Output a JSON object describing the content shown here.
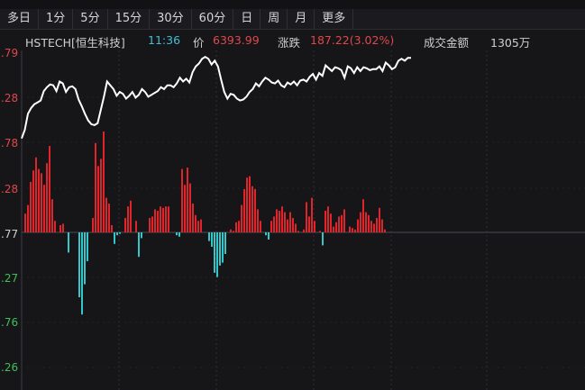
{
  "tabs": [
    {
      "label": "多日"
    },
    {
      "label": "1分"
    },
    {
      "label": "5分"
    },
    {
      "label": "15分"
    },
    {
      "label": "30分"
    },
    {
      "label": "60分"
    },
    {
      "label": "日"
    },
    {
      "label": "周"
    },
    {
      "label": "月"
    },
    {
      "label": "更多"
    }
  ],
  "quote": {
    "symbol": "HSTECH[恒生科技]",
    "time": "11:36",
    "price_label": "价",
    "price": "6393.99",
    "change_label": "涨跌",
    "change": "187.22(3.02%)",
    "amount_label": "成交金额",
    "amount": "1305万"
  },
  "colors": {
    "background": "#161619",
    "price_line": "#ffffff",
    "up": "#e0242b",
    "down": "#33c7c9",
    "axis_up_label": "#e0474b",
    "axis_down_label": "#3fbf5a",
    "symbol_text": "#cfcfcf",
    "time_text": "#3fbfd6",
    "value_text": "#e0474b"
  },
  "chart_data": {
    "type": "line",
    "price_axis": {
      "tick_labels": [
        ".79",
        ".28",
        ".78",
        ".28",
        ".77",
        ".27",
        ".76",
        ".26"
      ]
    },
    "price_line_values": [
      6206,
      6215,
      6232,
      6238,
      6242,
      6244,
      6246,
      6256,
      6260,
      6263,
      6262,
      6256,
      6266,
      6264,
      6255,
      6260,
      6261,
      6258,
      6247,
      6240,
      6232,
      6225,
      6221,
      6220,
      6222,
      6236,
      6250,
      6266,
      6262,
      6258,
      6251,
      6255,
      6253,
      6248,
      6251,
      6255,
      6249,
      6252,
      6258,
      6255,
      6250,
      6252,
      6254,
      6256,
      6260,
      6258,
      6262,
      6262,
      6260,
      6264,
      6270,
      6266,
      6269,
      6265,
      6276,
      6282,
      6285,
      6290,
      6292,
      6290,
      6284,
      6288,
      6282,
      6268,
      6255,
      6248,
      6253,
      6252,
      6248,
      6246,
      6247,
      6250,
      6255,
      6258,
      6264,
      6261,
      6266,
      6270,
      6268,
      6265,
      6264,
      6267,
      6262,
      6260,
      6265,
      6263,
      6266,
      6262,
      6267,
      6268,
      6266,
      6271,
      6274,
      6268,
      6275,
      6272,
      6283,
      6280,
      6277,
      6281,
      6280,
      6278,
      6270,
      6282,
      6280,
      6275,
      6281,
      6277,
      6281,
      6280,
      6278,
      6279,
      6279,
      6282,
      6277,
      6286,
      6283,
      6279,
      6281,
      6288,
      6290,
      6288,
      6291,
      6291
    ],
    "bar_values": [
      13,
      19,
      35,
      43,
      52,
      44,
      41,
      33,
      48,
      60,
      23,
      8,
      0,
      5,
      6,
      0,
      -14,
      0,
      0,
      0,
      -45,
      -57,
      -36,
      -20,
      0,
      10,
      62,
      46,
      51,
      70,
      24,
      20,
      5,
      -8,
      -2,
      -1,
      0,
      10,
      18,
      22,
      0,
      8,
      -17,
      -4,
      0,
      0,
      10,
      11,
      16,
      15,
      18,
      17,
      18,
      18,
      0,
      0,
      -2,
      -3,
      44,
      33,
      45,
      34,
      20,
      12,
      8,
      9,
      0,
      0,
      -6,
      -10,
      -28,
      -31,
      -23,
      -21,
      -15,
      0,
      2,
      1,
      7,
      8,
      19,
      30,
      38,
      39,
      32,
      30,
      16,
      8,
      0,
      -2,
      -5,
      8,
      11,
      16,
      15,
      18,
      14,
      9,
      14,
      10,
      6,
      1,
      0,
      2,
      21,
      11,
      24,
      8,
      0,
      1,
      -9,
      15,
      18,
      13,
      4,
      7,
      11,
      12,
      16,
      0,
      4,
      3,
      2,
      9,
      14,
      23,
      14,
      12,
      8,
      6,
      10,
      17,
      9,
      2,
      0
    ]
  }
}
